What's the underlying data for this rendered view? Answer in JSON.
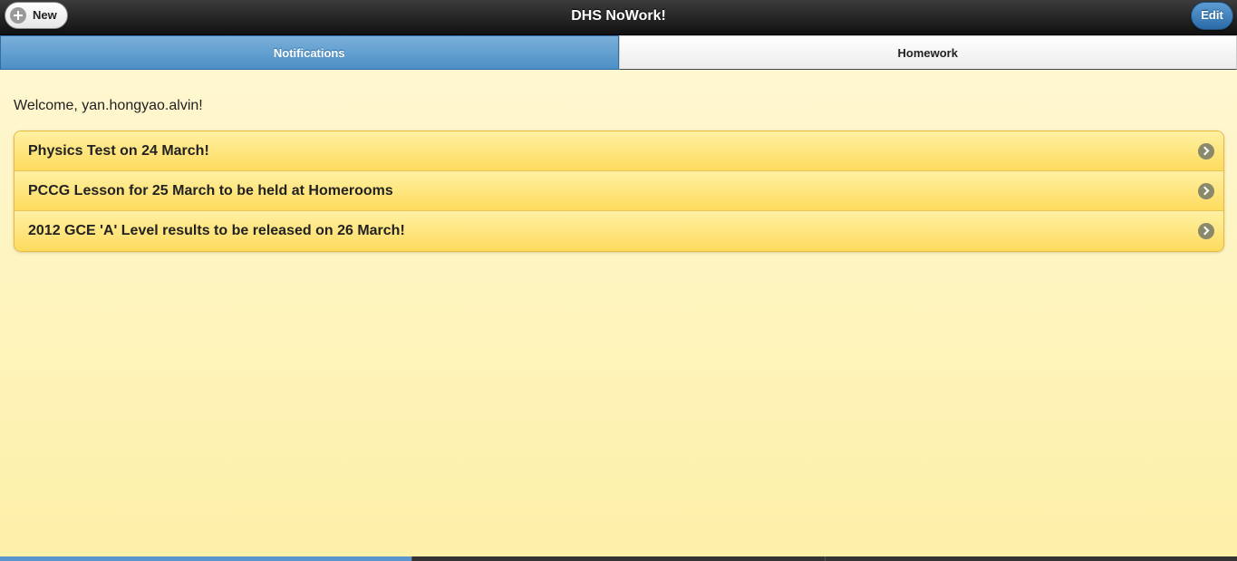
{
  "header": {
    "title": "DHS NoWork!",
    "new_label": "New",
    "new_icon": "plus-circle-icon",
    "edit_label": "Edit"
  },
  "tabs": [
    {
      "label": "Notifications",
      "active": true
    },
    {
      "label": "Homework",
      "active": false
    }
  ],
  "main": {
    "welcome": "Welcome, yan.hongyao.alvin!",
    "notifications": [
      {
        "text": "Physics Test on 24 March!",
        "icon": "chevron-right-icon"
      },
      {
        "text": "PCCG Lesson for 25 March to be held at Homerooms",
        "icon": "chevron-right-icon"
      },
      {
        "text": "2012 GCE 'A' Level results to be released on 26 March!",
        "icon": "chevron-right-icon"
      }
    ]
  },
  "footer": {
    "segments": 3,
    "active_segment": 0
  },
  "colors": {
    "header_bg": "#1c1c1c",
    "accent_blue": "#4d8fc6",
    "list_yellow": "#fddb5e",
    "page_bg": "#fdf0a8"
  }
}
